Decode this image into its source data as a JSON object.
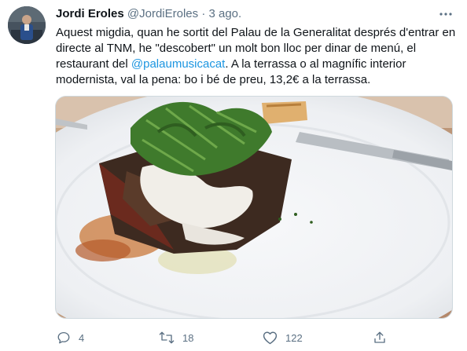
{
  "author": {
    "name": "Jordi Eroles",
    "handle": "@JordiEroles",
    "separator": "·",
    "date": "3 ago."
  },
  "tweet": {
    "text_part1": "Aquest migdia, quan he sortit del Palau de la Generalitat després d'entrar en directe al TNM, he \"descobert\" un molt bon lloc per dinar de menú, el restaurant del ",
    "mention": "@palaumusicacat",
    "text_part2": ". A la terrassa o al magnífic interior modernista, val la pena: bo i bé de preu, 13,2€ a la terrassa."
  },
  "actions": {
    "replies": "4",
    "retweets": "18",
    "likes": "122"
  },
  "icons": {
    "more": "more-dots-icon",
    "reply": "reply-icon",
    "retweet": "retweet-icon",
    "like": "heart-icon",
    "share": "share-icon"
  },
  "colors": {
    "text": "#0f1419",
    "secondary": "#5b7083",
    "link": "#1b95e0"
  }
}
